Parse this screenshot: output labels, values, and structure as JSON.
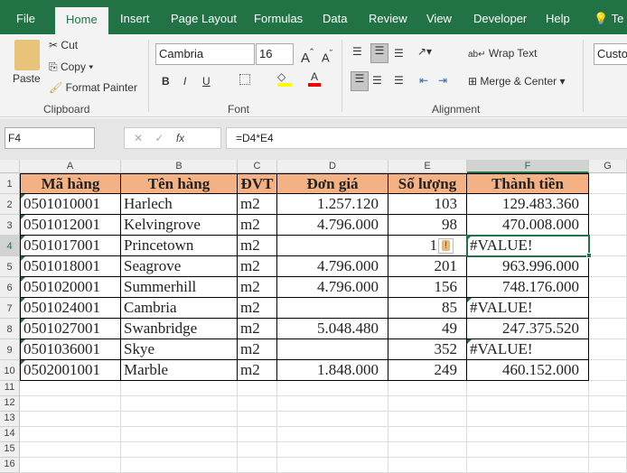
{
  "tabs": [
    "File",
    "Home",
    "Insert",
    "Page Layout",
    "Formulas",
    "Data",
    "Review",
    "View",
    "Developer",
    "Help",
    "Te"
  ],
  "ribbon": {
    "paste": "Paste",
    "cut": "Cut",
    "copy": "Copy",
    "format_painter": "Format Painter",
    "clipboard": "Clipboard",
    "font_name": "Cambria",
    "font_size": "16",
    "font": "Font",
    "wrap_text": "Wrap Text",
    "merge_center": "Merge & Center",
    "alignment": "Alignment",
    "number_format": "Custom",
    "bold": "B",
    "italic": "I",
    "underline": "U"
  },
  "formula_bar": {
    "name_box": "F4",
    "formula": "=D4*E4",
    "fx": "fx"
  },
  "columns": [
    "A",
    "B",
    "C",
    "D",
    "E",
    "F",
    "G"
  ],
  "headers": [
    "Mã hàng",
    "Tên hàng",
    "ĐVT",
    "Đơn giá",
    "Số lượng",
    "Thành tiền"
  ],
  "rows": [
    [
      "0501010001",
      "Harlech",
      "m2",
      "1.257.120",
      "103",
      "129.483.360"
    ],
    [
      "0501012001",
      "Kelvingrove",
      "m2",
      "4.796.000",
      "98",
      "470.008.000"
    ],
    [
      "0501017001",
      "Princetown",
      "m2",
      "",
      "1",
      "#VALUE!"
    ],
    [
      "0501018001",
      "Seagrove",
      "m2",
      "4.796.000",
      "201",
      "963.996.000"
    ],
    [
      "0501020001",
      "Summerhill",
      "m2",
      "4.796.000",
      "156",
      "748.176.000"
    ],
    [
      "0501024001",
      "Cambria",
      "m2",
      "",
      "85",
      "#VALUE!"
    ],
    [
      "0501027001",
      "Swanbridge",
      "m2",
      "5.048.480",
      "49",
      "247.375.520"
    ],
    [
      "0501036001",
      "Skye",
      "m2",
      "",
      "352",
      "#VALUE!"
    ],
    [
      "0502001001",
      "Marble",
      "m2",
      "1.848.000",
      "249",
      "460.152.000"
    ]
  ],
  "row_numbers": [
    "1",
    "2",
    "3",
    "4",
    "5",
    "6",
    "7",
    "8",
    "9",
    "10",
    "11",
    "12",
    "13",
    "14",
    "15",
    "16"
  ],
  "selected_cell": "F4"
}
